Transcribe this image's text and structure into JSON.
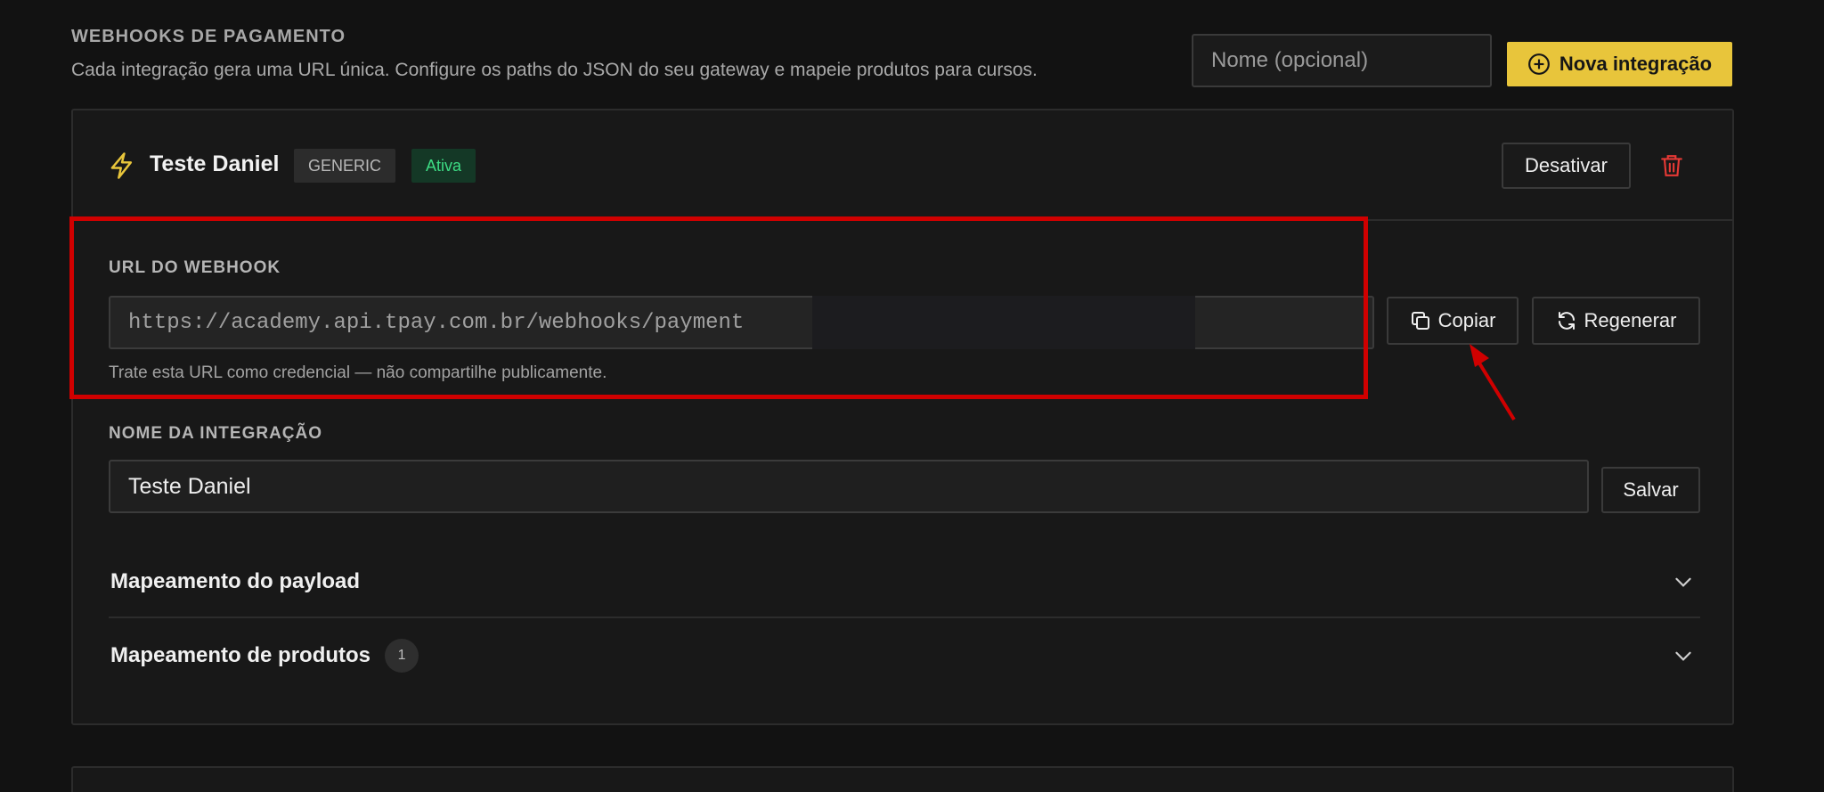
{
  "header": {
    "title": "WEBHOOKS DE PAGAMENTO",
    "description": "Cada integração gera uma URL única. Configure os paths do JSON do seu gateway e mapeie produtos para cursos.",
    "name_placeholder": "Nome (opcional)",
    "new_button_label": "Nova integração"
  },
  "integration": {
    "name": "Teste Daniel",
    "type_badge": "GENERIC",
    "status_badge": "Ativa",
    "deactivate_label": "Desativar",
    "url_label": "URL DO WEBHOOK",
    "url_value": "https://academy.api.tpay.com.br/webhooks/payment",
    "url_helper": "Trate esta URL como credencial — não compartilhe publicamente.",
    "copy_label": "Copiar",
    "regenerate_label": "Regenerar",
    "name_label": "NOME DA INTEGRAÇÃO",
    "name_value": "Teste Daniel",
    "save_label": "Salvar",
    "sections": [
      {
        "title": "Mapeamento do payload"
      },
      {
        "title": "Mapeamento de produtos",
        "count": "1"
      }
    ]
  },
  "colors": {
    "accent": "#e8c53b",
    "status_active": "#3ddc84",
    "danger": "#e53935",
    "annotation": "#d00000"
  },
  "icons": {
    "new": "plus-circle-icon",
    "bolt": "bolt-icon",
    "trash": "trash-icon",
    "copy": "copy-icon",
    "regenerate": "refresh-icon",
    "chevron": "chevron-down-icon"
  }
}
